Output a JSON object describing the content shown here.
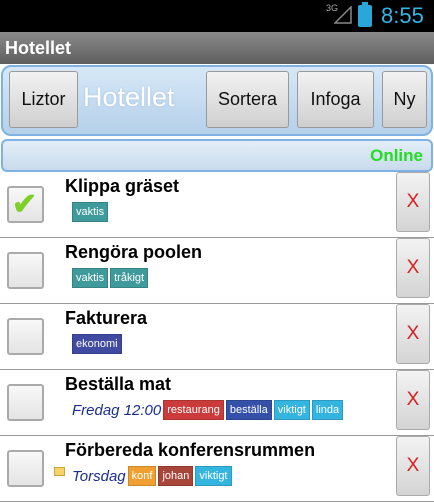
{
  "statusbar": {
    "network": "3G",
    "time": "8:55"
  },
  "app": {
    "title": "Hotellet"
  },
  "toolbar": {
    "lists_label": "Liztor",
    "list_name": "Hotellet",
    "sort_label": "Sortera",
    "insert_label": "Infoga",
    "new_label": "Ny"
  },
  "connection": {
    "status": "Online",
    "color": "#22dd22"
  },
  "tasks": [
    {
      "title": "Klippa gräset",
      "checked": true,
      "when": "",
      "tags": [
        {
          "label": "vaktis",
          "color": "#3f9b9b"
        }
      ],
      "delete_label": "X"
    },
    {
      "title": "Rengöra poolen",
      "checked": false,
      "when": "",
      "tags": [
        {
          "label": "vaktis",
          "color": "#3f9b9b"
        },
        {
          "label": "tråkigt",
          "color": "#3f9b9b"
        }
      ],
      "delete_label": "X"
    },
    {
      "title": "Fakturera",
      "checked": false,
      "when": "",
      "tags": [
        {
          "label": "ekonomi",
          "color": "#3f4aa0"
        }
      ],
      "delete_label": "X"
    },
    {
      "title": "Beställa mat",
      "checked": false,
      "when": "Fredag 12:00",
      "tags": [
        {
          "label": "restaurang",
          "color": "#cc3b3b"
        },
        {
          "label": "beställa",
          "color": "#3550a8"
        },
        {
          "label": "viktigt",
          "color": "#33b5e0"
        },
        {
          "label": "linda",
          "color": "#33b5e0"
        }
      ],
      "delete_label": "X"
    },
    {
      "title": "Förbereda konferensrummen",
      "checked": false,
      "when": "Torsdag",
      "has_note": true,
      "tags": [
        {
          "label": "konf",
          "color": "#f0a030"
        },
        {
          "label": "johan",
          "color": "#a8453a"
        },
        {
          "label": "viktigt",
          "color": "#33b5e0"
        }
      ],
      "delete_label": "X"
    }
  ]
}
